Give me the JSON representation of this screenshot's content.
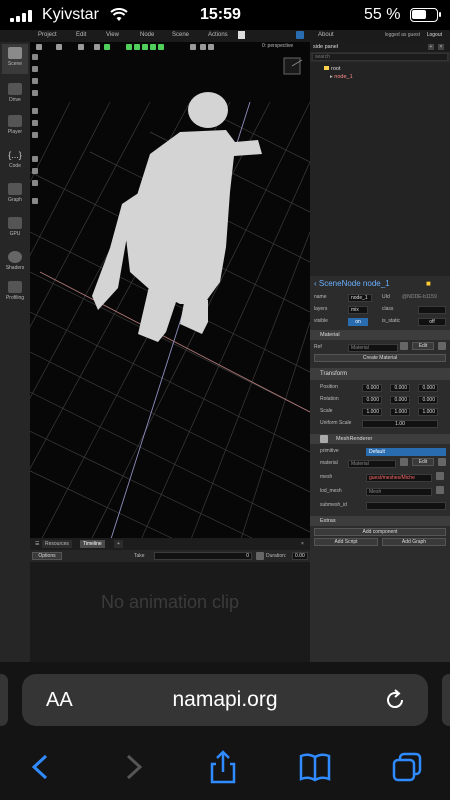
{
  "status": {
    "carrier": "Kyivstar",
    "time": "15:59",
    "battery": "55 %"
  },
  "menu": {
    "items": [
      "Project",
      "Edit",
      "View",
      "Node",
      "Scene",
      "Actions",
      "About"
    ],
    "logged": "logged as guest",
    "logout": "Logout"
  },
  "leftbar": {
    "items": [
      "Scene",
      "Drive",
      "Player",
      "Code",
      "Graph",
      "GPU",
      "Shaders",
      "Profiling"
    ]
  },
  "viewport": {
    "camera_label": "0: perspective"
  },
  "side_panel": {
    "title": "side panel",
    "filter_placeholder": "search",
    "tree": {
      "root": "root",
      "node": "node_1"
    },
    "node_title": "SceneNode node_1",
    "name_label": "name",
    "name_value": "node_1",
    "uid_label": "UId",
    "uid_value": "@NODE-b1159",
    "layers_label": "layers",
    "layers_value": "mix",
    "class_label": "class",
    "visible_label": "visible",
    "visible_value": "on",
    "is_static_label": "is_static",
    "is_static_value": "off",
    "material_section": "Material",
    "ref_label": "Ref",
    "ref_value": "Material",
    "edit_label": "Edit",
    "create_material": "Create Material",
    "transform_section": "Transform",
    "position_label": "Position",
    "position": [
      "0.000",
      "0.000",
      "0.000"
    ],
    "rotation_label": "Rotation",
    "rotation": [
      "0.000",
      "0.000",
      "0.000"
    ],
    "scale_label": "Scale",
    "scale": [
      "1.000",
      "1.000",
      "1.000"
    ],
    "uniform_label": "Uniform Scale",
    "uniform_value": "1.00",
    "mesh_section": "MeshRenderer",
    "primitive_label": "primitive",
    "primitive_value": "Default",
    "material_label": "material",
    "material_value": "Material",
    "mesh_label": "mesh",
    "mesh_value": "guest/meshes/Miche",
    "lod_label": "lod_mesh",
    "lod_value": "Mesh",
    "submesh_label": "submesh_id",
    "extras_section": "Extras",
    "add_component": "Add component",
    "add_script": "Add Script",
    "add_graph": "Add Graph"
  },
  "bottom": {
    "tabs": [
      "Resources",
      "Timeline"
    ],
    "options": "Options",
    "take": "Take",
    "take_value": "0",
    "duration_label": "Duration:",
    "duration_value": "0.00",
    "no_clip": "No animation clip"
  },
  "safari": {
    "aa": "AA",
    "host": "namapi.org"
  }
}
